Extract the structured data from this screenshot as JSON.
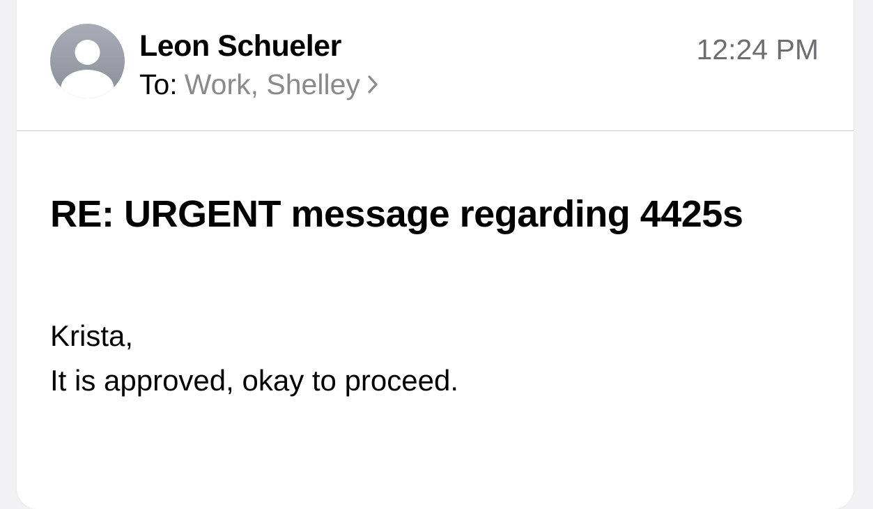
{
  "message": {
    "sender": "Leon Schueler",
    "to_label": "To:",
    "recipients": "Work, Shelley",
    "time": "12:24 PM",
    "subject": "RE: URGENT message regarding 4425s",
    "body": {
      "greeting": "Krista,",
      "text": "It is approved, okay to proceed."
    }
  },
  "icons": {
    "avatar": "person-avatar-icon",
    "recipients_disclosure": "chevron-right-icon"
  },
  "colors": {
    "background": "#f2f2f4",
    "card": "#ffffff",
    "secondary_text": "#8a8a8e",
    "avatar": "#9a9da6"
  }
}
